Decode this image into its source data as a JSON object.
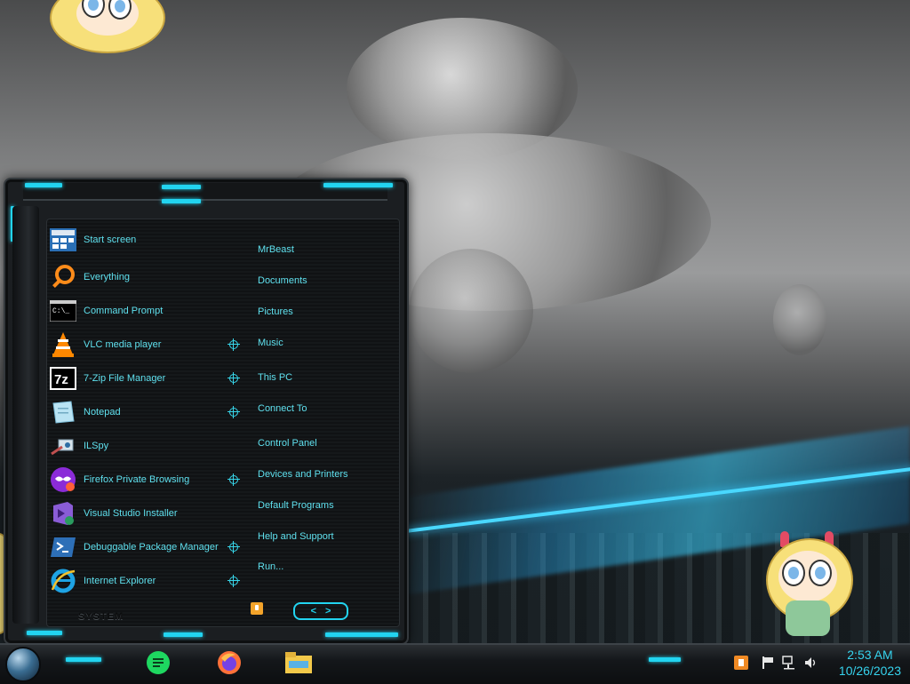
{
  "start_menu": {
    "system_label": "SYSTEM",
    "programs": [
      {
        "label": "Start screen",
        "icon": "start-screen-icon",
        "jump": false
      },
      {
        "label": "Everything",
        "icon": "everything-search-icon",
        "jump": false
      },
      {
        "label": "Command Prompt",
        "icon": "command-prompt-icon",
        "jump": false
      },
      {
        "label": "VLC media player",
        "icon": "vlc-icon",
        "jump": true
      },
      {
        "label": "7-Zip File Manager",
        "icon": "7zip-icon",
        "jump": true
      },
      {
        "label": "Notepad",
        "icon": "notepad-icon",
        "jump": true
      },
      {
        "label": "ILSpy",
        "icon": "ilspy-icon",
        "jump": false
      },
      {
        "label": "Firefox Private Browsing",
        "icon": "firefox-private-icon",
        "jump": true
      },
      {
        "label": "Visual Studio Installer",
        "icon": "visual-studio-installer-icon",
        "jump": false
      },
      {
        "label": "Debuggable Package Manager",
        "icon": "powershell-icon",
        "jump": true
      },
      {
        "label": "Internet Explorer",
        "icon": "internet-explorer-icon",
        "jump": true
      }
    ],
    "places": [
      "MrBeast",
      "Documents",
      "Pictures",
      "Music",
      "This PC",
      "Connect To",
      "Control Panel",
      "Devices and Printers",
      "Default Programs",
      "Help and Support",
      "Run..."
    ],
    "pager": {
      "prev": "<",
      "next": ">"
    }
  },
  "taskbar": {
    "pinned": [
      "spotify-icon",
      "firefox-icon",
      "file-explorer-icon"
    ],
    "tray": [
      "app-tray-icon",
      "flag-icon",
      "network-icon",
      "volume-icon"
    ],
    "clock": {
      "time": "2:53 AM",
      "date": "10/26/2023"
    }
  },
  "colors": {
    "accent": "#22d4f0",
    "text": "#5fe0ee"
  }
}
